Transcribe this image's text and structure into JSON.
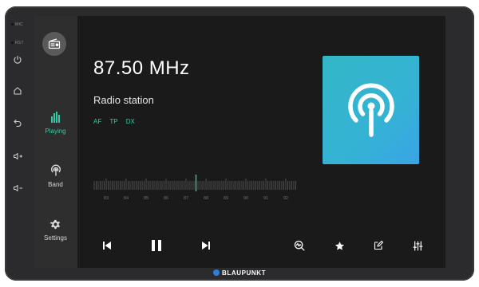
{
  "device": {
    "mic_label": "MIC",
    "rst_label": "RST",
    "brand": "BLAUPUNKT",
    "hardware_buttons": [
      "power-icon",
      "home-icon",
      "back-icon",
      "volume-up-icon",
      "volume-down-icon"
    ]
  },
  "sidebar": {
    "items": [
      {
        "label": "Playing",
        "icon": "equalizer-bars-icon",
        "active": true
      },
      {
        "label": "Band",
        "icon": "broadcast-icon",
        "active": false
      },
      {
        "label": "Settings",
        "icon": "gear-icon",
        "active": false
      }
    ]
  },
  "radio": {
    "frequency": "87.50 MHz",
    "station": "Radio station",
    "flags": [
      "AF",
      "TP",
      "DX"
    ],
    "tuner_ticks": [
      "83",
      "84",
      "85",
      "86",
      "87",
      "88",
      "89",
      "90",
      "91",
      "92"
    ],
    "current_mhz": 87.5,
    "accent_color": "#35c9a8",
    "art_icon": "broadcast-antenna-icon"
  },
  "controls": [
    "previous-icon",
    "pause-icon",
    "next-icon",
    "search-scan-icon",
    "star-icon",
    "edit-icon",
    "equalizer-sliders-icon"
  ]
}
